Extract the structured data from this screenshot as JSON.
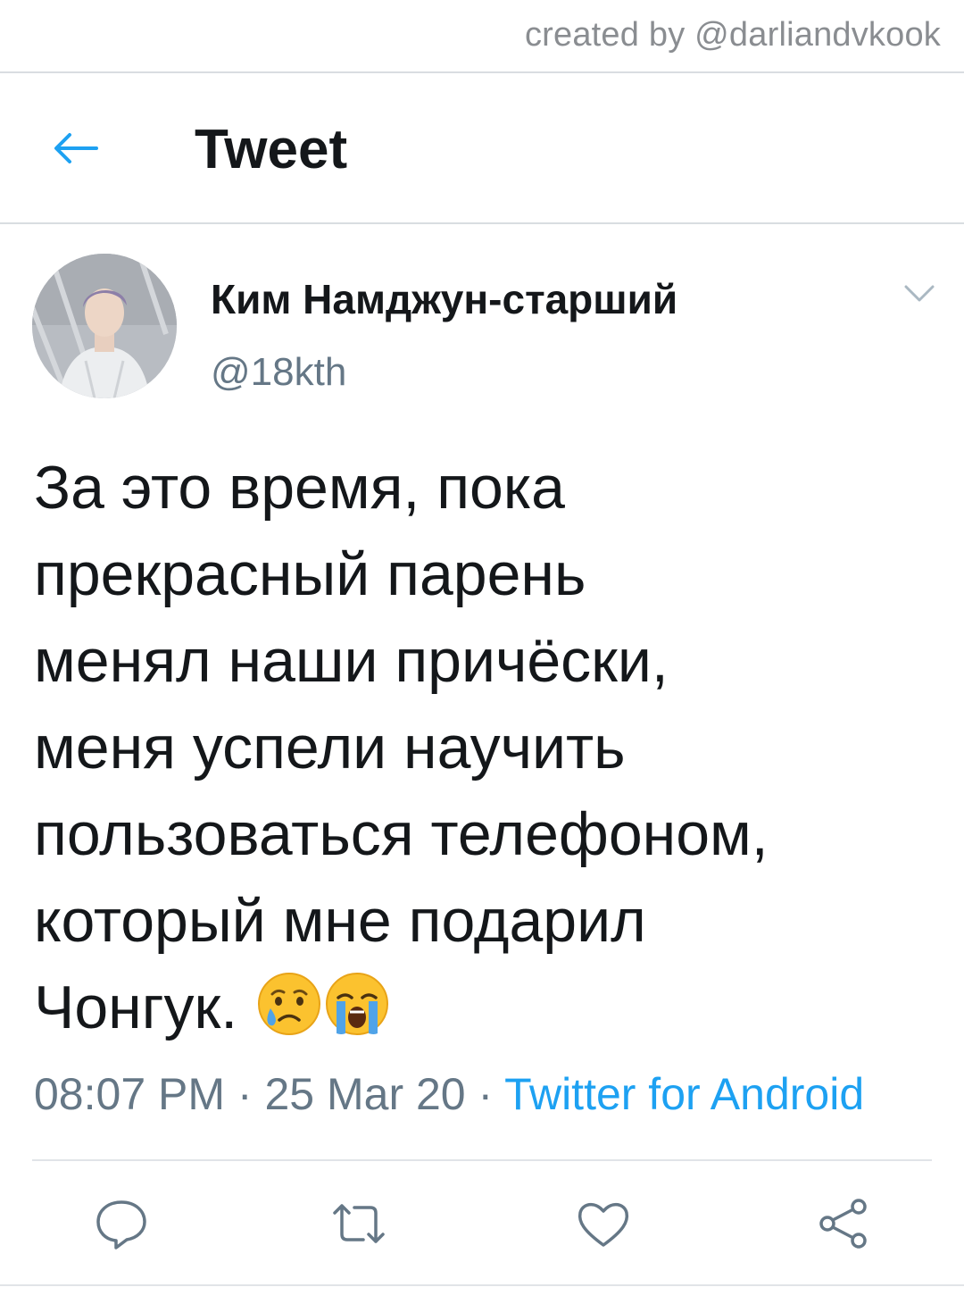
{
  "watermark": "created by @darliandvkook",
  "header": {
    "back_icon": "arrow-left-icon",
    "title": "Tweet"
  },
  "tweet": {
    "author": {
      "display_name": "Ким Намджун-старший",
      "handle": "@18kth",
      "avatar": "user-avatar-photo"
    },
    "menu_icon": "chevron-down-icon",
    "text_lines": [
      "За это время, пока",
      "прекрасный парень",
      "менял наши причёски,",
      "меня успели научить",
      "пользоваться телефоном,",
      "который мне подарил",
      "Чонгук."
    ],
    "emojis": [
      "crying-face-emoji",
      "loudly-crying-face-emoji"
    ],
    "time": "08:07 PM",
    "separator": "·",
    "date": "25 Mar 20",
    "source": "Twitter for Android"
  },
  "actions": {
    "reply_icon": "reply-icon",
    "retweet_icon": "retweet-icon",
    "like_icon": "heart-icon",
    "share_icon": "share-icon"
  },
  "colors": {
    "accent": "#1da1f2",
    "secondary_text": "#657786",
    "primary_text": "#14171a",
    "divider": "#e1e4e8"
  }
}
